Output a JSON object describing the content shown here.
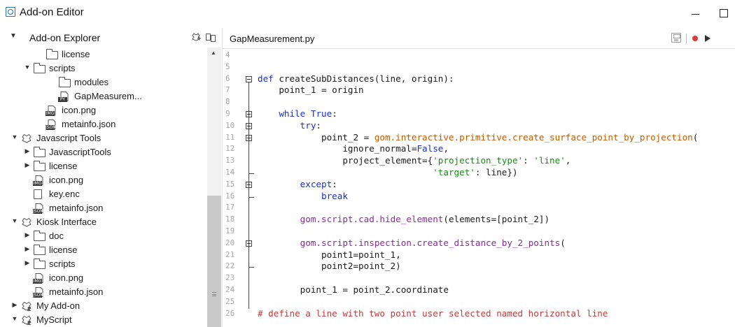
{
  "window": {
    "title": "Add-on Editor"
  },
  "explorer": {
    "title": "Add-on Explorer",
    "items": [
      {
        "label": "license",
        "icon": "folder-icon",
        "caret": ""
      },
      {
        "label": "scripts",
        "icon": "folder-icon",
        "caret": "▼"
      },
      {
        "label": "modules",
        "icon": "folder-icon",
        "caret": ""
      },
      {
        "label": "GapMeasurem...",
        "icon": "python-file-icon",
        "caret": "",
        "badge": "PY"
      },
      {
        "label": "icon.png",
        "icon": "image-file-icon",
        "caret": "",
        "badge": "IMG"
      },
      {
        "label": "metainfo.json",
        "icon": "json-file-icon",
        "caret": "",
        "badge": "JSON"
      },
      {
        "label": "Javascript Tools",
        "icon": "addon-icon",
        "caret": "▼"
      },
      {
        "label": "JavascriptTools",
        "icon": "folder-icon",
        "caret": "▶"
      },
      {
        "label": "license",
        "icon": "folder-icon",
        "caret": "▶"
      },
      {
        "label": "icon.png",
        "icon": "image-file-icon",
        "caret": "",
        "badge": "IMG"
      },
      {
        "label": "key.enc",
        "icon": "file-icon",
        "caret": ""
      },
      {
        "label": "metainfo.json",
        "icon": "json-file-icon",
        "caret": "",
        "badge": "JSON"
      },
      {
        "label": "Kiosk Interface",
        "icon": "addon-icon",
        "caret": "▼"
      },
      {
        "label": "doc",
        "icon": "folder-icon",
        "caret": "▶"
      },
      {
        "label": "license",
        "icon": "folder-icon",
        "caret": "▶"
      },
      {
        "label": "scripts",
        "icon": "folder-icon",
        "caret": "▶"
      },
      {
        "label": "icon.png",
        "icon": "image-file-icon",
        "caret": "",
        "badge": "IMG"
      },
      {
        "label": "metainfo.json",
        "icon": "json-file-icon",
        "caret": "",
        "badge": "JSON"
      },
      {
        "label": "My Add-on",
        "icon": "addon-user-icon",
        "caret": "▶"
      },
      {
        "label": "MyScript",
        "icon": "addon-user-icon",
        "caret": "▼"
      }
    ]
  },
  "editor": {
    "tab_label": "GapMeasurement.py",
    "lines": [
      {
        "n": "4",
        "code": ""
      },
      {
        "n": "5",
        "code": ""
      },
      {
        "n": "6",
        "code": "def createSubDistances(line, origin):"
      },
      {
        "n": "7",
        "code": "    point_1 = origin"
      },
      {
        "n": "8",
        "code": ""
      },
      {
        "n": "9",
        "code": "    while True:"
      },
      {
        "n": "10",
        "code": "        try:"
      },
      {
        "n": "11",
        "code": "            point_2 = gom.interactive.primitive.create_surface_point_by_projection("
      },
      {
        "n": "12",
        "code": "                ignore_normal=False,"
      },
      {
        "n": "13",
        "code": "                project_element={'projection_type': 'line',"
      },
      {
        "n": "14",
        "code": "                                 'target': line})"
      },
      {
        "n": "15",
        "code": "        except:"
      },
      {
        "n": "16",
        "code": "            break"
      },
      {
        "n": "17",
        "code": ""
      },
      {
        "n": "18",
        "code": "        gom.script.cad.hide_element(elements=[point_2])"
      },
      {
        "n": "19",
        "code": ""
      },
      {
        "n": "20",
        "code": "        gom.script.inspection.create_distance_by_2_points("
      },
      {
        "n": "21",
        "code": "            point1=point_1,"
      },
      {
        "n": "22",
        "code": "            point2=point_2)"
      },
      {
        "n": "23",
        "code": ""
      },
      {
        "n": "24",
        "code": "        point_1 = point_2.coordinate"
      },
      {
        "n": "25",
        "code": ""
      },
      {
        "n": "26",
        "code": "# define a line with two point user selected named horizontal line"
      }
    ]
  },
  "colors": {
    "keyword": "#1a2fd0",
    "function_call": "#c25a00",
    "script_call": "#8a2a9a",
    "string": "#1a8a1a",
    "comment": "#c23a3a",
    "record": "#e0383e"
  }
}
